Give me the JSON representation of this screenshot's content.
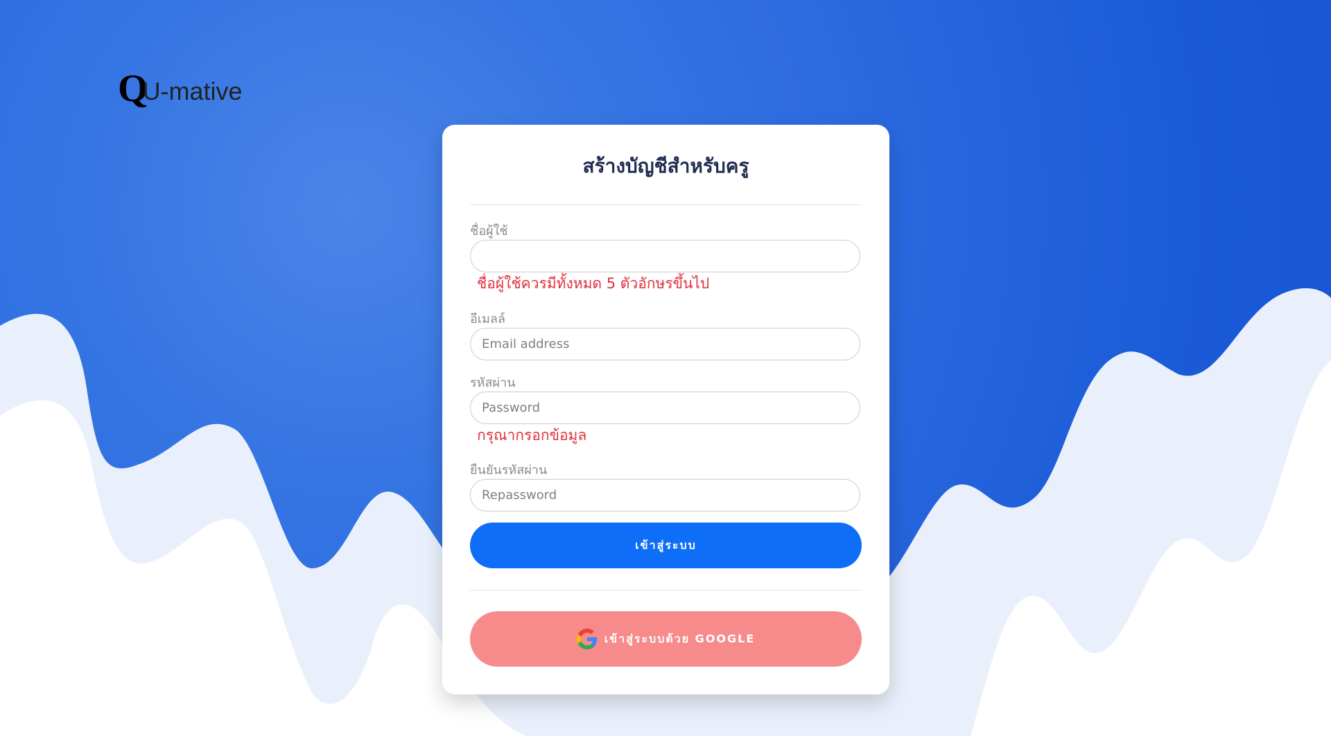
{
  "logo": {
    "q": "Q",
    "rest": "U-mative"
  },
  "card": {
    "title": "สร้างบัญชีสำหรับครู"
  },
  "form": {
    "username": {
      "label": "ชื่อผู้ใช้",
      "value": "",
      "placeholder": "",
      "error": "ชื่อผู้ใช้ควรมีทั้งหมด 5 ตัวอักษรขึ้นไป"
    },
    "email": {
      "label": "อีเมลล์",
      "value": "",
      "placeholder": "Email address"
    },
    "password": {
      "label": "รหัสผ่าน",
      "value": "",
      "placeholder": "Password",
      "error": "กรุณากรอกข้อมูล"
    },
    "repassword": {
      "label": "ยืนยันรหัสผ่าน",
      "value": "",
      "placeholder": "Repassword"
    }
  },
  "buttons": {
    "submit_label": "เข้าสู่ระบบ",
    "google_label": "เข้าสู่ระบบด้วย GOOGLE",
    "google_icon": "google-icon"
  },
  "colors": {
    "primary": "#0e6ef7",
    "google_button": "#f78b8b",
    "error": "#e0303b",
    "background": "#2c6ae0"
  }
}
